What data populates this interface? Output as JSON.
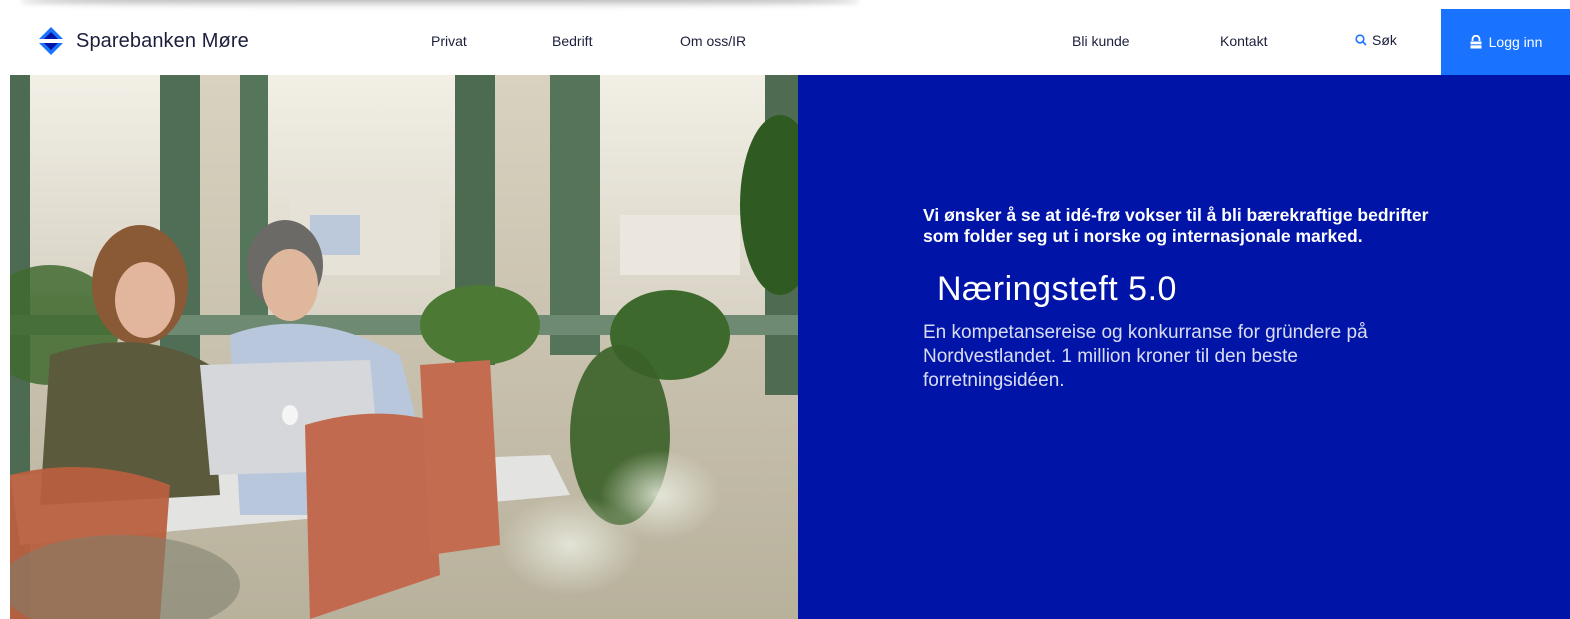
{
  "brand": {
    "name": "Sparebanken Møre"
  },
  "nav": {
    "primary": [
      "Privat",
      "Bedrift",
      "Om oss/IR"
    ],
    "secondary": [
      "Bli kunde",
      "Kontakt"
    ],
    "search_label": "Søk",
    "login_label": "Logg inn"
  },
  "hero": {
    "intro": "Vi ønsker å se at idé-frø vokser til å bli bærekraftige bedrifter som folder seg ut i norske og internasjonale marked.",
    "title": "Næringsteft 5.0",
    "description": "En kompetansereise og konkurranse for gründere på Nordvestlandet. 1 million kroner til den beste forretningsidéen."
  },
  "colors": {
    "panel": "#0015a8",
    "login_bg": "#1a73ff",
    "logo_blue": "#1a73ff",
    "text_dark": "#1b1f3b"
  },
  "icons": {
    "logo": "diamond-logo-icon",
    "search": "search-icon",
    "login": "lock-icon"
  }
}
